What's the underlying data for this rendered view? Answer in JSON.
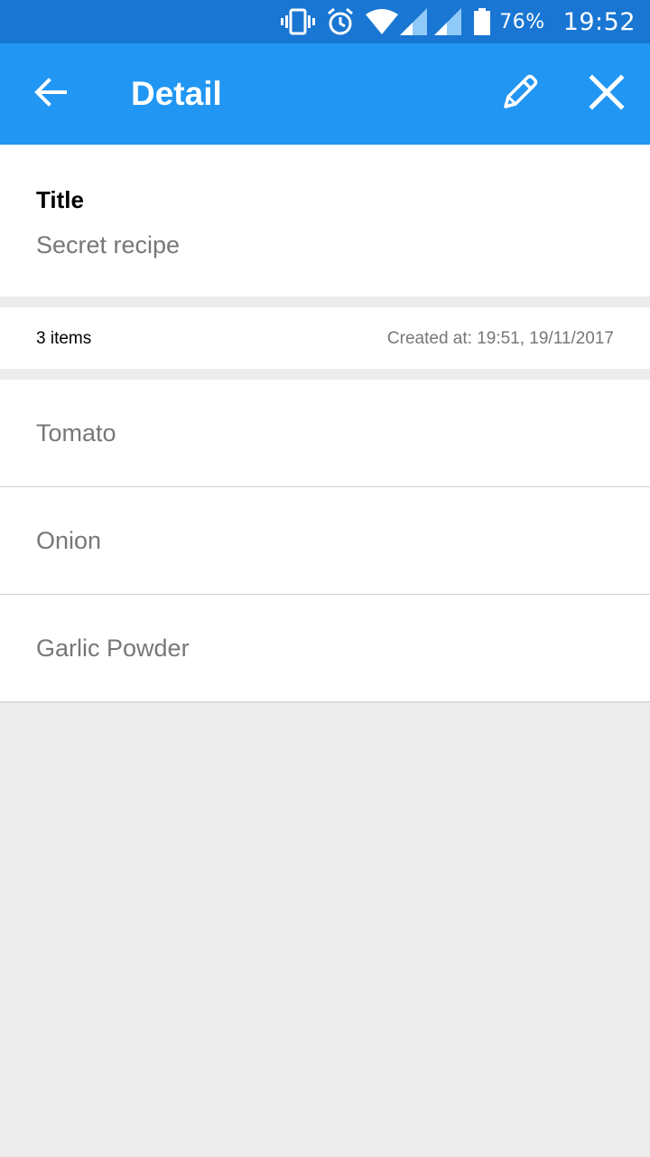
{
  "status_bar": {
    "icons": [
      "vibrate-icon",
      "alarm-icon",
      "wifi-icon",
      "signal-icon",
      "signal-icon",
      "battery-icon"
    ],
    "battery_percent": "76%",
    "time": "19:52"
  },
  "app_bar": {
    "title": "Detail",
    "back_icon": "arrow-back-icon",
    "edit_icon": "pencil-icon",
    "close_icon": "close-icon"
  },
  "title_section": {
    "label": "Title",
    "value": "Secret recipe"
  },
  "meta": {
    "item_count": "3 items",
    "created_at": "Created at: 19:51, 19/11/2017"
  },
  "items": [
    {
      "label": "Tomato"
    },
    {
      "label": "Onion"
    },
    {
      "label": "Garlic Powder"
    }
  ],
  "colors": {
    "status_bar": "#1976d2",
    "app_bar": "#2196f3",
    "background": "#ececec",
    "secondary_text": "#777777"
  }
}
